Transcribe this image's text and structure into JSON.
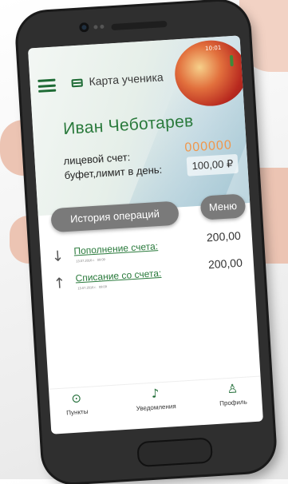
{
  "header": {
    "card_title": "Карта ученика",
    "status_time": "10:01"
  },
  "student": {
    "name": "Иван Чеботарев",
    "account_label": "лицевой счет:",
    "account_value": "000000",
    "limit_label": "буфет,лимит в день:",
    "limit_value": "100,00 ₽"
  },
  "buttons": {
    "history": "История операций",
    "menu": "Меню"
  },
  "transactions": [
    {
      "title": "Пополнение счета:",
      "date": "13.07.2016 г.",
      "time": "09:09",
      "amount": "200,00",
      "direction": "down"
    },
    {
      "title": "Списание со счета:",
      "date": "13.07.2016 г.",
      "time": "09:09",
      "amount": "200,00",
      "direction": "up"
    }
  ],
  "nav": {
    "items": [
      {
        "label": "Пункты",
        "icon": "location-pin-icon"
      },
      {
        "label": "Уведомления",
        "icon": "bell-icon"
      },
      {
        "label": "Профиль",
        "icon": "user-icon"
      }
    ]
  },
  "colors": {
    "accent_green": "#1e6b35",
    "name_green": "#2a7a3c",
    "account_orange": "#f0964a",
    "button_gray": "#7a7a7a"
  }
}
